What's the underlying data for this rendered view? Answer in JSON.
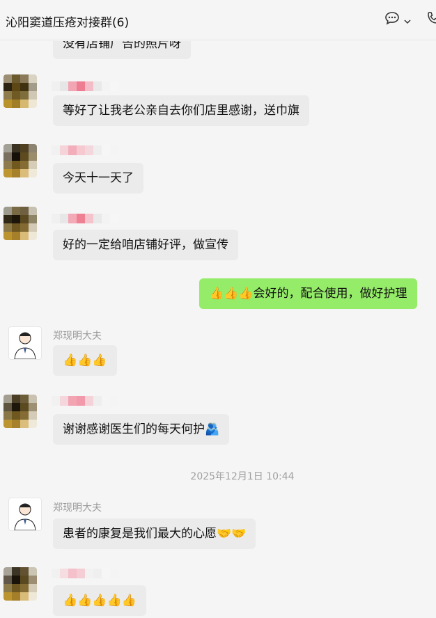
{
  "header": {
    "title": "沁阳窦道压疮对接群(6)",
    "chat_icon": "chat-bubble-icon",
    "dropdown_icon": "chevron-down-icon",
    "call_icon": "phone-icon"
  },
  "messages": [
    {
      "type": "in",
      "text": "没有店铺广告的照片呀"
    },
    {
      "type": "in",
      "text": "等好了让我老公亲自去你们店里感谢，送巾旗"
    },
    {
      "type": "in",
      "text": "今天十一天了"
    },
    {
      "type": "in",
      "text": "好的一定给咱店铺好评，做宣传"
    },
    {
      "type": "out",
      "text": "👍👍👍会好的，配合使用，做好护理"
    },
    {
      "type": "in",
      "sender": "郑现明大夫",
      "text": "👍👍👍"
    },
    {
      "type": "in",
      "text": "谢谢感谢医生们的每天何护🫂"
    },
    {
      "type": "time",
      "text": "2025年12月1日 10:44"
    },
    {
      "type": "in",
      "sender": "郑现明大夫",
      "text": "患者的康复是我们最大的心愿🤝🤝"
    },
    {
      "type": "in",
      "text": "👍👍👍👍👍"
    }
  ],
  "colors": {
    "out_bubble": "#95ec69",
    "in_bubble": "#ebebeb",
    "background": "#f5f5f5"
  }
}
